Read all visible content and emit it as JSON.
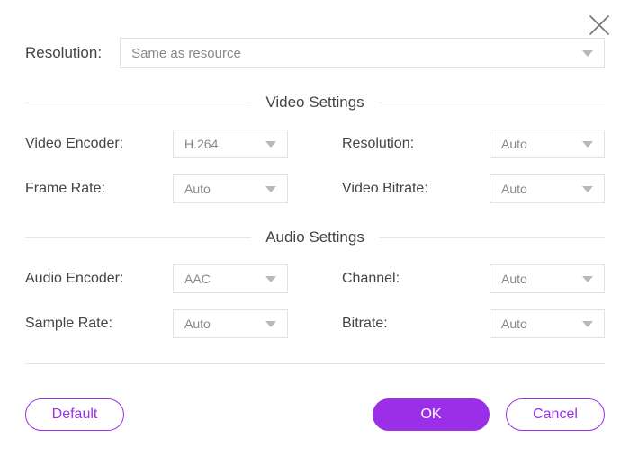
{
  "top": {
    "resolution_label": "Resolution:",
    "resolution_value": "Same as resource"
  },
  "video": {
    "section_title": "Video Settings",
    "encoder_label": "Video Encoder:",
    "encoder_value": "H.264",
    "resolution_label": "Resolution:",
    "resolution_value": "Auto",
    "framerate_label": "Frame Rate:",
    "framerate_value": "Auto",
    "bitrate_label": "Video Bitrate:",
    "bitrate_value": "Auto"
  },
  "audio": {
    "section_title": "Audio Settings",
    "encoder_label": "Audio Encoder:",
    "encoder_value": "AAC",
    "channel_label": "Channel:",
    "channel_value": "Auto",
    "samplerate_label": "Sample Rate:",
    "samplerate_value": "Auto",
    "bitrate_label": "Bitrate:",
    "bitrate_value": "Auto"
  },
  "buttons": {
    "default": "Default",
    "ok": "OK",
    "cancel": "Cancel"
  }
}
